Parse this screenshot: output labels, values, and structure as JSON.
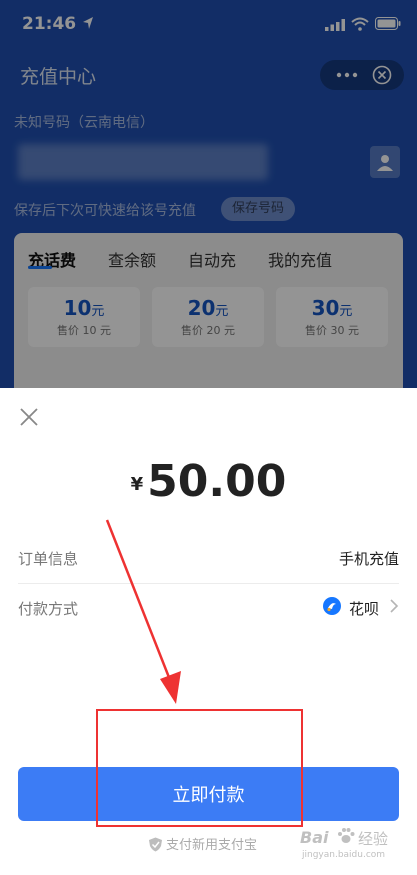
{
  "status_bar": {
    "time": "21:46"
  },
  "background_page": {
    "title": "充值中心",
    "carrier_label": "未知号码（云南电信）",
    "save_hint": "保存后下次可快速给该号充值",
    "save_button": "保存号码",
    "tabs": [
      {
        "label": "充话费",
        "active": true
      },
      {
        "label": "查余额",
        "active": false
      },
      {
        "label": "自动充",
        "active": false
      },
      {
        "label": "我的充值",
        "active": false
      }
    ],
    "amounts": [
      {
        "value": "10",
        "unit": "元",
        "price": "售价 10 元"
      },
      {
        "value": "20",
        "unit": "元",
        "price": "售价 20 元"
      },
      {
        "value": "30",
        "unit": "元",
        "price": "售价 30 元"
      }
    ]
  },
  "payment_sheet": {
    "currency": "¥",
    "amount": "50.00",
    "order_label": "订单信息",
    "order_value": "手机充值",
    "method_label": "付款方式",
    "method_value": "花呗",
    "pay_button": "立即付款",
    "footer": "支付新用支付宝"
  },
  "watermark": {
    "brand": "Bai",
    "brand2": "经验",
    "url": "jingyan.baidu.com"
  },
  "colors": {
    "brand_blue": "#1f4fb0",
    "pay_button": "#3c7cf5",
    "annotation_red": "#ee3232",
    "tab_accent": "#1677ff"
  },
  "icons": [
    "location-arrow-icon",
    "signal-icon",
    "wifi-icon",
    "battery-icon",
    "more-icon",
    "close-circle-icon",
    "contact-icon",
    "close-icon",
    "huabei-icon",
    "chevron-right-icon",
    "shield-icon",
    "paw-icon"
  ]
}
